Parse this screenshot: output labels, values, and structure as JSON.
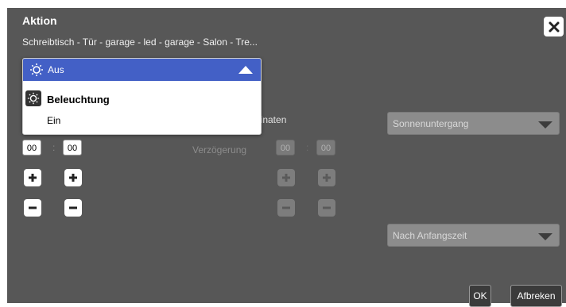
{
  "dialog": {
    "title": "Aktion",
    "subtitle": "Schreibtisch - Tür - garage - led - garage - Salon - Tre..."
  },
  "action_dropdown": {
    "selected_label": "Aus",
    "group_label": "Beleuchtung",
    "options": [
      "Ein"
    ]
  },
  "coordinates_label_partial": "linaten",
  "time": {
    "hours": "00",
    "minutes": "00",
    "separator": ":"
  },
  "delay": {
    "label": "Verzögerung",
    "hours": "00",
    "minutes": "00",
    "separator": ":"
  },
  "right_selects": {
    "sun_event": "Sonnenuntergang",
    "time_mode": "Nach Anfangszeit"
  },
  "buttons": {
    "ok": "OK",
    "cancel": "Afbreken"
  },
  "icons": [
    "close-icon",
    "lightbulb-icon",
    "plus-icon",
    "minus-icon",
    "caret-up-icon",
    "caret-down-icon"
  ],
  "colors": {
    "dialog_bg": "#575757",
    "accent_blue": "#4360c6"
  }
}
